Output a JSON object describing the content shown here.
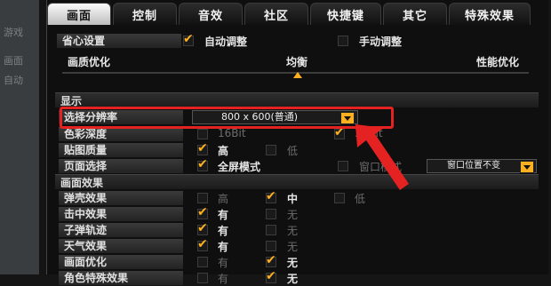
{
  "tabs": [
    "画面",
    "控制",
    "音效",
    "社区",
    "快捷键",
    "其它",
    "特殊效果"
  ],
  "preset": {
    "title": "省心设置",
    "auto": "自动调整",
    "manual": "手动调整"
  },
  "quality": {
    "low": "画质优化",
    "mid": "均衡",
    "high": "性能优化"
  },
  "display": {
    "title": "显示",
    "resolution_label": "选择分辨率",
    "resolution_value": "800 x 600(普通)",
    "color_depth_label": "色彩深度",
    "color_16": "16Bit",
    "color_32": "32Bit",
    "texture_label": "贴图质量",
    "texture_high": "高",
    "texture_low": "低",
    "window_label": "页面选择",
    "fullscreen": "全屏模式",
    "windowed": "窗口模式",
    "window_pos": "窗口位置不变"
  },
  "effects": {
    "title": "画面效果",
    "rows": [
      {
        "label": "弹壳效果",
        "options": [
          "高",
          "中",
          "低"
        ],
        "checked": 1
      },
      {
        "label": "击中效果",
        "options": [
          "有",
          "无"
        ],
        "checked": 0
      },
      {
        "label": "子弹轨迹",
        "options": [
          "有",
          "无"
        ],
        "checked": 0
      },
      {
        "label": "天气效果",
        "options": [
          "有",
          "无"
        ],
        "checked": 0
      },
      {
        "label": "画面优化",
        "options": [
          "有",
          "无"
        ],
        "checked": 1
      },
      {
        "label": "角色特殊效果",
        "options": [
          "有",
          "无"
        ],
        "checked": 1
      }
    ]
  },
  "colors": {
    "accent": "#ffb020",
    "highlight": "#e52222"
  }
}
